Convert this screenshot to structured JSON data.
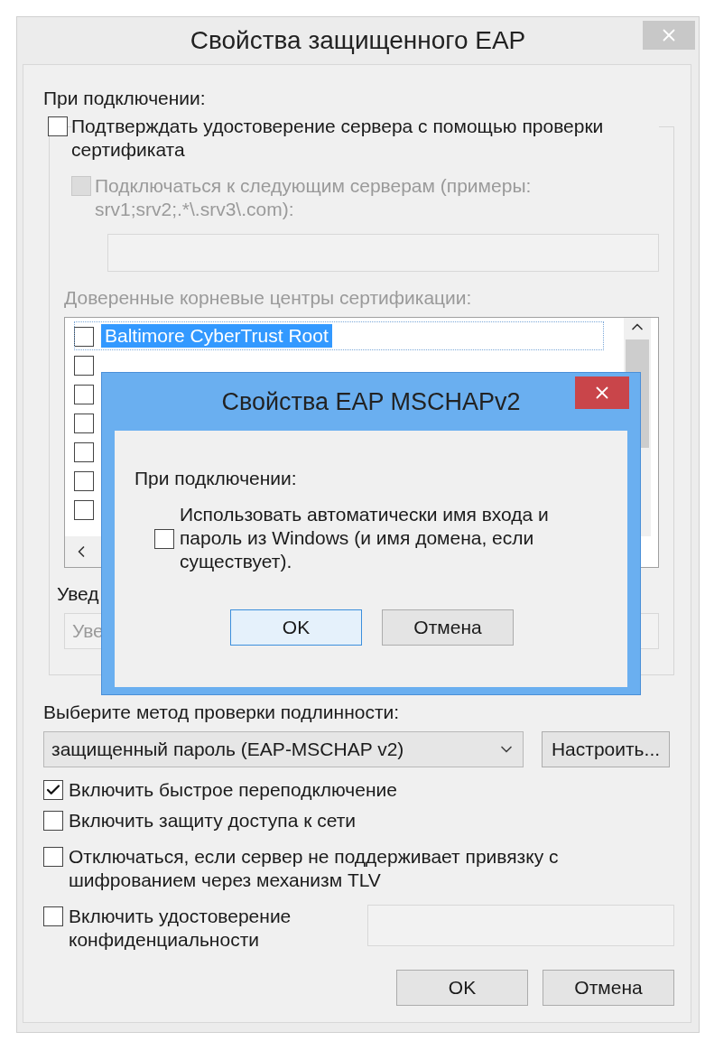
{
  "window": {
    "title": "Свойства защищенного EAP"
  },
  "on_connect_label": "При подключении:",
  "validate_server": {
    "label": "Подтверждать удостоверение сервера с помощью проверки сертификата",
    "checked": false
  },
  "connect_servers": {
    "label": "Подключаться к следующим серверам (примеры: srv1;srv2;.*\\.srv3\\.com):",
    "checked": false,
    "disabled": true
  },
  "trusted_ca": {
    "label": "Доверенные корневые центры сертификации:",
    "disabled": true
  },
  "certificates": [
    {
      "name": "Baltimore CyberTrust Root",
      "checked": false,
      "selected": true
    },
    {
      "checked": false,
      "selected": false
    },
    {
      "checked": false,
      "selected": false
    },
    {
      "checked": false,
      "selected": false
    },
    {
      "checked": false,
      "selected": false
    },
    {
      "checked": false,
      "selected": false
    },
    {
      "checked": false,
      "selected": false
    }
  ],
  "notifications_label": "Увед",
  "notifications_dropdown": {
    "value": "Уве",
    "disabled": true
  },
  "auth_method_label": "Выберите метод проверки подлинности:",
  "auth_method": {
    "value": "защищенный пароль (EAP-MSCHAP v2)"
  },
  "configure_button": "Настроить...",
  "options": [
    {
      "label": "Включить быстрое переподключение",
      "checked": true
    },
    {
      "label": "Включить защиту доступа к сети",
      "checked": false
    },
    {
      "label": "Отключаться, если сервер не поддерживает привязку с шифрованием через механизм TLV",
      "checked": false
    },
    {
      "label": "Включить удостоверение конфиденциальности",
      "checked": false,
      "kind": "with-field"
    }
  ],
  "buttons": [
    {
      "label": "OK",
      "default": false
    },
    {
      "label": "Отмена",
      "default": false
    }
  ],
  "modal": {
    "title": "Свойства EAP MSCHAPv2",
    "section_label": "При подключении:",
    "auto_login": {
      "label": "Использовать автоматически имя входа и пароль из Windows (и имя домена, если существует).",
      "checked": false
    },
    "buttons": [
      {
        "label": "OK",
        "default": true
      },
      {
        "label": "Отмена",
        "default": false
      }
    ]
  }
}
